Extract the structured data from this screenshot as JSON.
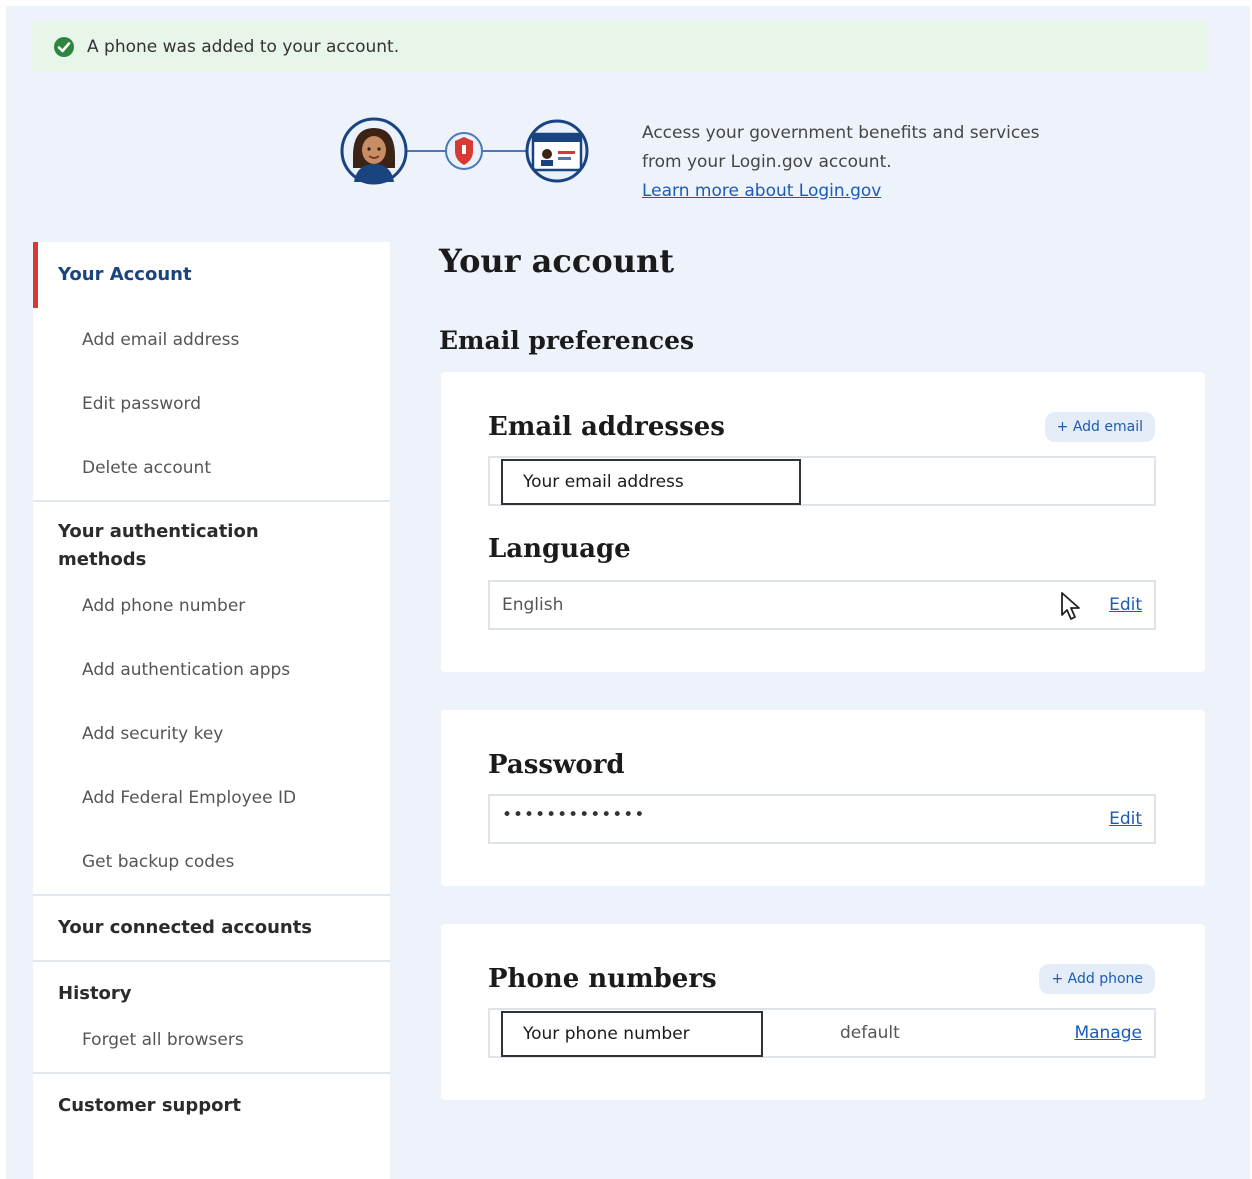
{
  "alert": {
    "message": "A phone was added to your account.",
    "color": "#2e8540"
  },
  "banner": {
    "line1": "Access your government benefits and services",
    "line2": "from your Login.gov account.",
    "link": "Learn more about Login.gov"
  },
  "sidebar": {
    "your_account": "Your Account",
    "account_items": [
      "Add email address",
      "Edit password",
      "Delete account"
    ],
    "auth_heading": "Your authentication methods",
    "auth_items": [
      "Add phone number",
      "Add authentication apps",
      "Add security key",
      "Add Federal Employee ID",
      "Get backup codes"
    ],
    "connected_heading": "Your connected accounts",
    "history_heading": "History",
    "history_items": [
      "Forget all browsers"
    ],
    "support_heading": "Customer support",
    "active_color": "#d83933"
  },
  "main": {
    "title": "Your account",
    "email_prefs_title": "Email preferences",
    "email_card": {
      "heading": "Email addresses",
      "add_button": "+ Add email",
      "email_placeholder": "Your email address",
      "language_heading": "Language",
      "language_value": "English",
      "language_edit": "Edit"
    },
    "password_card": {
      "heading": "Password",
      "value": "•••••••••••••",
      "edit": "Edit"
    },
    "phone_card": {
      "heading": "Phone numbers",
      "add_button": "+ Add phone",
      "phone_placeholder": "Your phone number",
      "default_label": "default",
      "manage": "Manage"
    },
    "link_color": "#1a5bb5"
  }
}
